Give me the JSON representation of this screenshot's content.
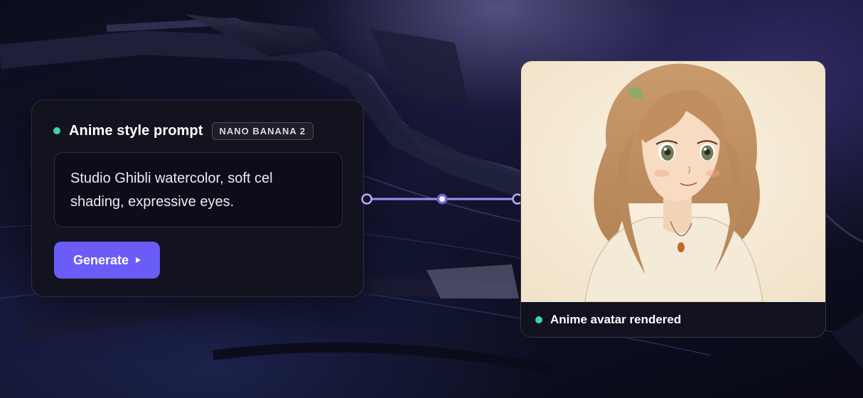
{
  "prompt_card": {
    "title": "Anime style prompt",
    "model_badge": "NANO BANANA 2",
    "prompt_text": "Studio Ghibli watercolor, soft cel shading, expressive eyes.",
    "generate_label": "Generate"
  },
  "output_card": {
    "status_text": "Anime avatar rendered"
  },
  "colors": {
    "accent": "#6a5cf6",
    "status_green": "#3fd3a8",
    "connector": "#9d8ff2"
  },
  "icons": {
    "generate_icon": "play-triangle-icon",
    "status_icon": "status-dot-icon"
  }
}
